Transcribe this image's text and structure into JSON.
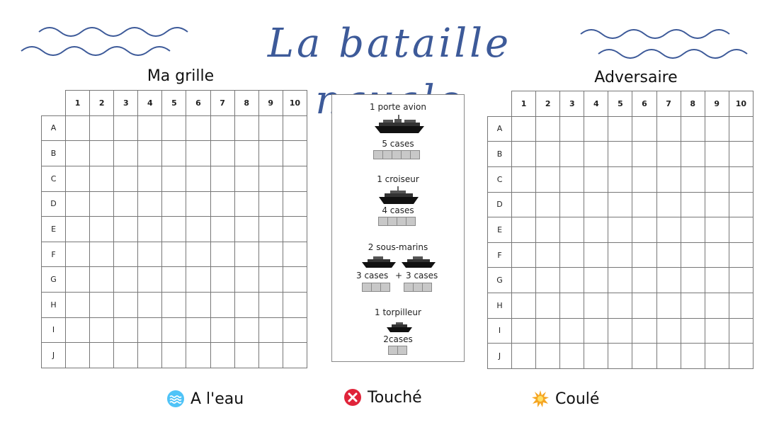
{
  "title": "La bataille navale",
  "my_grid": {
    "title": "Ma grille",
    "columns": [
      "1",
      "2",
      "3",
      "4",
      "5",
      "6",
      "7",
      "8",
      "9",
      "10"
    ],
    "rows": [
      "A",
      "B",
      "C",
      "D",
      "E",
      "F",
      "G",
      "H",
      "I",
      "J"
    ]
  },
  "opponent_grid": {
    "title": "Adversaire",
    "columns": [
      "1",
      "2",
      "3",
      "4",
      "5",
      "6",
      "7",
      "8",
      "9",
      "10"
    ],
    "rows": [
      "A",
      "B",
      "C",
      "D",
      "E",
      "F",
      "G",
      "H",
      "I",
      "J"
    ]
  },
  "fleet": {
    "carrier": {
      "label": "1 porte avion",
      "cells_label": "5 cases",
      "cells": 5
    },
    "cruiser": {
      "label": "1 croiseur",
      "cells_label": "4 cases",
      "cells": 4
    },
    "submarines": {
      "label": "2 sous-marins",
      "cells_label_a": "3 cases",
      "plus": "+",
      "cells_label_b": "3 cases",
      "cells": 3
    },
    "torpedo": {
      "label": "1 torpilleur",
      "cells_label": "2cases",
      "cells": 2
    }
  },
  "legend": [
    {
      "icon": "water-wave-icon",
      "label": "A l'eau",
      "color": "#4fc3f7"
    },
    {
      "icon": "red-cross-icon",
      "label": "Touché",
      "color": "#e0243a"
    },
    {
      "icon": "explosion-icon",
      "label": "Coulé",
      "color": "#f5a623"
    }
  ],
  "colors": {
    "title": "#3d5a99",
    "waves": "#3d5a99"
  }
}
